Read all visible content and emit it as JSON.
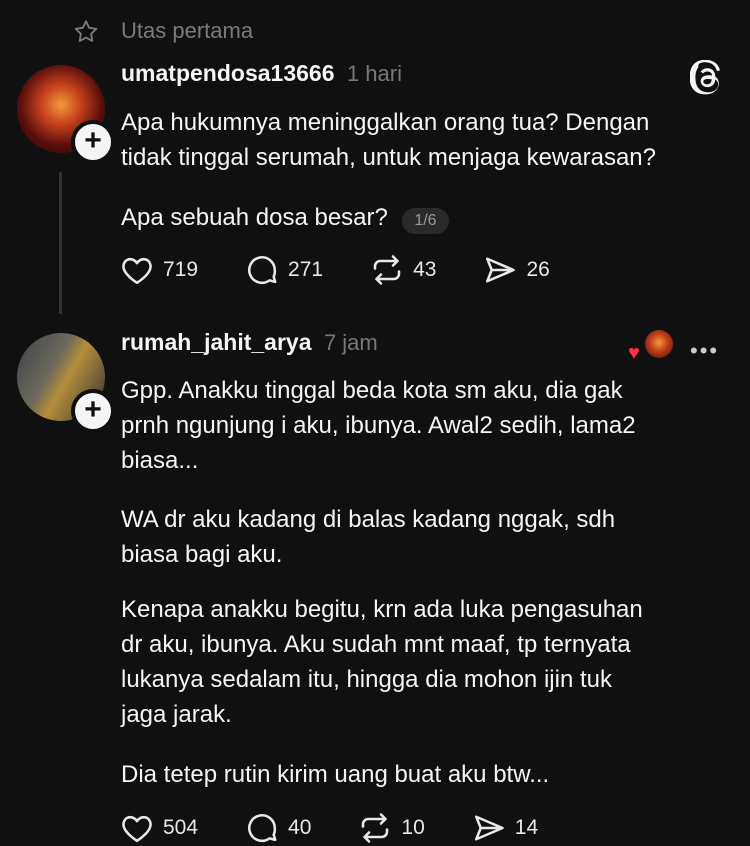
{
  "header": {
    "label": "Utas pertama",
    "icon": "star-icon"
  },
  "posts": [
    {
      "username": "umatpendosa13666",
      "time": "1 hari",
      "text": "Apa hukumnya meninggalkan orang tua? Dengan\ntidak tinggal serumah, untuk menjaga kewarasan?",
      "text2": "Apa sebuah dosa besar?",
      "page_badge": "1/6",
      "likes": "719",
      "comments": "271",
      "reposts": "43",
      "shares": "26"
    },
    {
      "username": "rumah_jahit_arya",
      "time": "7 jam",
      "paragraphs": [
        "Gpp. Anakku tinggal beda kota sm aku, dia gak\nprnh ngunjung i aku, ibunya. Awal2 sedih, lama2\nbiasa...",
        "WA dr aku kadang di balas kadang nggak, sdh\nbiasa bagi aku.",
        "Kenapa anakku begitu, krn ada luka pengasuhan\ndr aku, ibunya. Aku sudah mnt maaf, tp ternyata\nlukanya sedalam itu, hingga dia mohon ijin tuk\njaga jarak.",
        "Dia tetep rutin kirim uang buat aku btw..."
      ],
      "likes": "504",
      "comments": "40",
      "reposts": "10",
      "shares": "14",
      "more": "•••"
    }
  ],
  "colors": {
    "background": "#101010",
    "text": "#f3f5f7",
    "muted": "#777777",
    "heart": "#ff3040"
  }
}
